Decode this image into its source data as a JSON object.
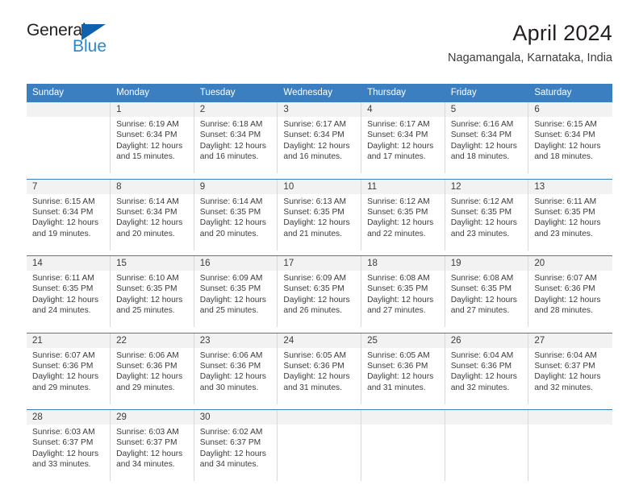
{
  "brand": {
    "name_part1": "General",
    "name_part2": "Blue",
    "triangle_icon": "triangle-icon",
    "accent_dark": "#231f20",
    "accent_blue": "#2a87d0",
    "triangle_color": "#1162ad"
  },
  "header": {
    "title": "April 2024",
    "subtitle": "Nagamangala, Karnataka, India"
  },
  "theme": {
    "header_bg": "#3c7fc0",
    "header_text": "#ffffff",
    "daynum_bg": "#f2f2f2",
    "cell_bg": "#ffffff",
    "text": "#3b3b3b",
    "grid_line": "#d9d9d9"
  },
  "weekday_headers": [
    "Sunday",
    "Monday",
    "Tuesday",
    "Wednesday",
    "Thursday",
    "Friday",
    "Saturday"
  ],
  "weeks": [
    {
      "days": [
        {
          "num": "",
          "empty": true,
          "lines": []
        },
        {
          "num": "1",
          "empty": false,
          "lines": [
            "Sunrise: 6:19 AM",
            "Sunset: 6:34 PM",
            "Daylight: 12 hours",
            "and 15 minutes."
          ]
        },
        {
          "num": "2",
          "empty": false,
          "lines": [
            "Sunrise: 6:18 AM",
            "Sunset: 6:34 PM",
            "Daylight: 12 hours",
            "and 16 minutes."
          ]
        },
        {
          "num": "3",
          "empty": false,
          "lines": [
            "Sunrise: 6:17 AM",
            "Sunset: 6:34 PM",
            "Daylight: 12 hours",
            "and 16 minutes."
          ]
        },
        {
          "num": "4",
          "empty": false,
          "lines": [
            "Sunrise: 6:17 AM",
            "Sunset: 6:34 PM",
            "Daylight: 12 hours",
            "and 17 minutes."
          ]
        },
        {
          "num": "5",
          "empty": false,
          "lines": [
            "Sunrise: 6:16 AM",
            "Sunset: 6:34 PM",
            "Daylight: 12 hours",
            "and 18 minutes."
          ]
        },
        {
          "num": "6",
          "empty": false,
          "lines": [
            "Sunrise: 6:15 AM",
            "Sunset: 6:34 PM",
            "Daylight: 12 hours",
            "and 18 minutes."
          ]
        }
      ]
    },
    {
      "days": [
        {
          "num": "7",
          "empty": false,
          "lines": [
            "Sunrise: 6:15 AM",
            "Sunset: 6:34 PM",
            "Daylight: 12 hours",
            "and 19 minutes."
          ]
        },
        {
          "num": "8",
          "empty": false,
          "lines": [
            "Sunrise: 6:14 AM",
            "Sunset: 6:34 PM",
            "Daylight: 12 hours",
            "and 20 minutes."
          ]
        },
        {
          "num": "9",
          "empty": false,
          "lines": [
            "Sunrise: 6:14 AM",
            "Sunset: 6:35 PM",
            "Daylight: 12 hours",
            "and 20 minutes."
          ]
        },
        {
          "num": "10",
          "empty": false,
          "lines": [
            "Sunrise: 6:13 AM",
            "Sunset: 6:35 PM",
            "Daylight: 12 hours",
            "and 21 minutes."
          ]
        },
        {
          "num": "11",
          "empty": false,
          "lines": [
            "Sunrise: 6:12 AM",
            "Sunset: 6:35 PM",
            "Daylight: 12 hours",
            "and 22 minutes."
          ]
        },
        {
          "num": "12",
          "empty": false,
          "lines": [
            "Sunrise: 6:12 AM",
            "Sunset: 6:35 PM",
            "Daylight: 12 hours",
            "and 23 minutes."
          ]
        },
        {
          "num": "13",
          "empty": false,
          "lines": [
            "Sunrise: 6:11 AM",
            "Sunset: 6:35 PM",
            "Daylight: 12 hours",
            "and 23 minutes."
          ]
        }
      ]
    },
    {
      "days": [
        {
          "num": "14",
          "empty": false,
          "lines": [
            "Sunrise: 6:11 AM",
            "Sunset: 6:35 PM",
            "Daylight: 12 hours",
            "and 24 minutes."
          ]
        },
        {
          "num": "15",
          "empty": false,
          "lines": [
            "Sunrise: 6:10 AM",
            "Sunset: 6:35 PM",
            "Daylight: 12 hours",
            "and 25 minutes."
          ]
        },
        {
          "num": "16",
          "empty": false,
          "lines": [
            "Sunrise: 6:09 AM",
            "Sunset: 6:35 PM",
            "Daylight: 12 hours",
            "and 25 minutes."
          ]
        },
        {
          "num": "17",
          "empty": false,
          "lines": [
            "Sunrise: 6:09 AM",
            "Sunset: 6:35 PM",
            "Daylight: 12 hours",
            "and 26 minutes."
          ]
        },
        {
          "num": "18",
          "empty": false,
          "lines": [
            "Sunrise: 6:08 AM",
            "Sunset: 6:35 PM",
            "Daylight: 12 hours",
            "and 27 minutes."
          ]
        },
        {
          "num": "19",
          "empty": false,
          "lines": [
            "Sunrise: 6:08 AM",
            "Sunset: 6:35 PM",
            "Daylight: 12 hours",
            "and 27 minutes."
          ]
        },
        {
          "num": "20",
          "empty": false,
          "lines": [
            "Sunrise: 6:07 AM",
            "Sunset: 6:36 PM",
            "Daylight: 12 hours",
            "and 28 minutes."
          ]
        }
      ]
    },
    {
      "days": [
        {
          "num": "21",
          "empty": false,
          "lines": [
            "Sunrise: 6:07 AM",
            "Sunset: 6:36 PM",
            "Daylight: 12 hours",
            "and 29 minutes."
          ]
        },
        {
          "num": "22",
          "empty": false,
          "lines": [
            "Sunrise: 6:06 AM",
            "Sunset: 6:36 PM",
            "Daylight: 12 hours",
            "and 29 minutes."
          ]
        },
        {
          "num": "23",
          "empty": false,
          "lines": [
            "Sunrise: 6:06 AM",
            "Sunset: 6:36 PM",
            "Daylight: 12 hours",
            "and 30 minutes."
          ]
        },
        {
          "num": "24",
          "empty": false,
          "lines": [
            "Sunrise: 6:05 AM",
            "Sunset: 6:36 PM",
            "Daylight: 12 hours",
            "and 31 minutes."
          ]
        },
        {
          "num": "25",
          "empty": false,
          "lines": [
            "Sunrise: 6:05 AM",
            "Sunset: 6:36 PM",
            "Daylight: 12 hours",
            "and 31 minutes."
          ]
        },
        {
          "num": "26",
          "empty": false,
          "lines": [
            "Sunrise: 6:04 AM",
            "Sunset: 6:36 PM",
            "Daylight: 12 hours",
            "and 32 minutes."
          ]
        },
        {
          "num": "27",
          "empty": false,
          "lines": [
            "Sunrise: 6:04 AM",
            "Sunset: 6:37 PM",
            "Daylight: 12 hours",
            "and 32 minutes."
          ]
        }
      ]
    },
    {
      "days": [
        {
          "num": "28",
          "empty": false,
          "lines": [
            "Sunrise: 6:03 AM",
            "Sunset: 6:37 PM",
            "Daylight: 12 hours",
            "and 33 minutes."
          ]
        },
        {
          "num": "29",
          "empty": false,
          "lines": [
            "Sunrise: 6:03 AM",
            "Sunset: 6:37 PM",
            "Daylight: 12 hours",
            "and 34 minutes."
          ]
        },
        {
          "num": "30",
          "empty": false,
          "lines": [
            "Sunrise: 6:02 AM",
            "Sunset: 6:37 PM",
            "Daylight: 12 hours",
            "and 34 minutes."
          ]
        },
        {
          "num": "",
          "empty": true,
          "lines": []
        },
        {
          "num": "",
          "empty": true,
          "lines": []
        },
        {
          "num": "",
          "empty": true,
          "lines": []
        },
        {
          "num": "",
          "empty": true,
          "lines": []
        }
      ]
    }
  ]
}
